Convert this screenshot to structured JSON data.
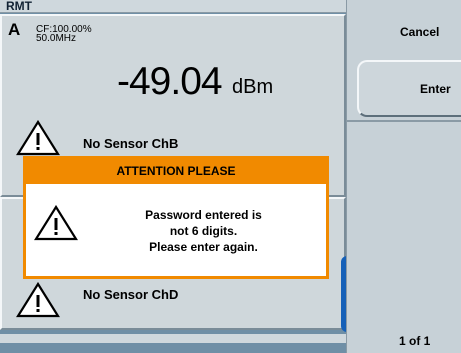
{
  "status_bar": {
    "mode": "RMT"
  },
  "channel_a": {
    "label": "A",
    "cf": "CF:100.00%",
    "frequency": "50.0MHz",
    "value": "-49.04",
    "unit": "dBm"
  },
  "sensor_b": {
    "text": "No Sensor ChB"
  },
  "sensor_d": {
    "text": "No Sensor ChD"
  },
  "dialog": {
    "title": "ATTENTION PLEASE",
    "lines": [
      "Password entered is",
      "not 6 digits.",
      "Please enter again."
    ]
  },
  "softkeys": {
    "cancel": "Cancel",
    "enter": "Enter",
    "page": "1 of 1"
  },
  "colors": {
    "dialog_accent": "#f18a00",
    "softkey_bg": "#c7d1d7",
    "panel_bg": "#cfd7db",
    "tab_blue": "#1560b8"
  }
}
